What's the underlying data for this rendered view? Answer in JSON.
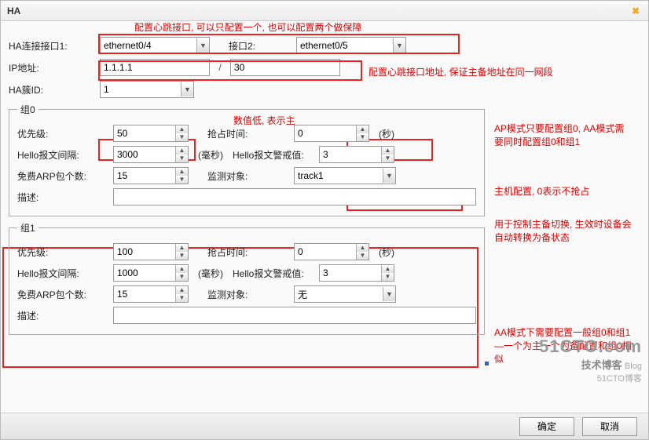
{
  "title": "HA",
  "notes": {
    "top": "配置心跳接口, 可以只配置一个, 也可以配置两个做保障",
    "ip": "配置心跳接口地址, 保证主备地址在同一网段",
    "lowval": "数值低, 表示主",
    "ap": "AP模式只要配置组0, AA模式需要同时配置组0和组1",
    "preempt": "主机配置, 0表示不抢占",
    "track": "用于控制主备切换, 生效时设备会自动转换为备状态",
    "aa": "AA模式下需要配置一般组0和组1—一个为主一个为备配置和组0相似"
  },
  "labels": {
    "ha_if1": "HA连接接口1:",
    "if2": "接口2:",
    "ip": "IP地址:",
    "cluster": "HA簇ID:"
  },
  "values": {
    "if1": "ethernet0/4",
    "if2": "ethernet0/5",
    "ip": "1.1.1.1",
    "mask": "30",
    "cluster": "1"
  },
  "group0": {
    "legend": "组0",
    "priority_lbl": "优先级:",
    "priority": "50",
    "preempt_lbl": "抢占时间:",
    "preempt": "0",
    "sec": "(秒)",
    "hello_lbl": "Hello报文间隔:",
    "hello": "3000",
    "ms": "(毫秒)",
    "warn_lbl": "Hello报文警戒值:",
    "warn": "3",
    "arp_lbl": "免费ARP包个数:",
    "arp": "15",
    "mon_lbl": "监测对象:",
    "mon": "track1",
    "desc_lbl": "描述:"
  },
  "group1": {
    "legend": "组1",
    "priority_lbl": "优先级:",
    "priority": "100",
    "preempt_lbl": "抢占时间:",
    "preempt": "0",
    "sec": "(秒)",
    "hello_lbl": "Hello报文间隔:",
    "hello": "1000",
    "ms": "(毫秒)",
    "warn_lbl": "Hello报文警戒值:",
    "warn": "3",
    "arp_lbl": "免费ARP包个数:",
    "arp": "15",
    "mon_lbl": "监测对象:",
    "mon": "无",
    "desc_lbl": "描述:"
  },
  "buttons": {
    "ok": "确定",
    "cancel": "取消"
  },
  "watermark": {
    "site": "51CTO.com",
    "en": "Blog",
    "cn": "技术博客",
    "tag": "51CTO博客"
  }
}
